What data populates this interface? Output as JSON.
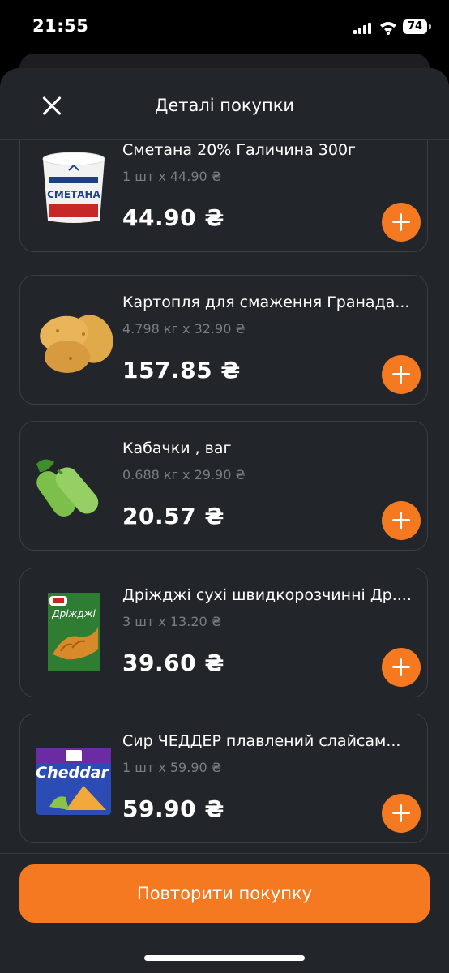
{
  "status_bar": {
    "time": "21:55",
    "battery": "74"
  },
  "header": {
    "title": "Деталі покупки"
  },
  "items": [
    {
      "name": "Сметана 20% Галичина 300г",
      "qty": "1 шт x 44.90 ₴",
      "price": "44.90 ₴",
      "icon": "sour-cream-cup",
      "image_text": "СМЕТАНА"
    },
    {
      "name": "Картопля для смаження  Гранада...",
      "qty": "4.798 кг x 32.90 ₴",
      "price": "157.85 ₴",
      "icon": "potatoes"
    },
    {
      "name": "Кабачки , ваг",
      "qty": "0.688 кг x 29.90 ₴",
      "price": "20.57 ₴",
      "icon": "zucchini"
    },
    {
      "name": "Дріжджі сухі швидкорозчинні Др....",
      "qty": "3 шт x 13.20 ₴",
      "price": "39.60 ₴",
      "icon": "yeast-pack",
      "image_text": "Дріжджі"
    },
    {
      "name": "Сир ЧЕДДЕР плавлений слайсам...",
      "qty": "1 шт x 59.90 ₴",
      "price": "59.90 ₴",
      "icon": "cheddar-pack",
      "image_text": "Cheddar"
    }
  ],
  "footer": {
    "repeat_label": "Повторити покупку"
  },
  "colors": {
    "accent": "#f47920",
    "background": "#22252a",
    "card_border": "#3a3d44",
    "muted_text": "#7a7d84"
  }
}
